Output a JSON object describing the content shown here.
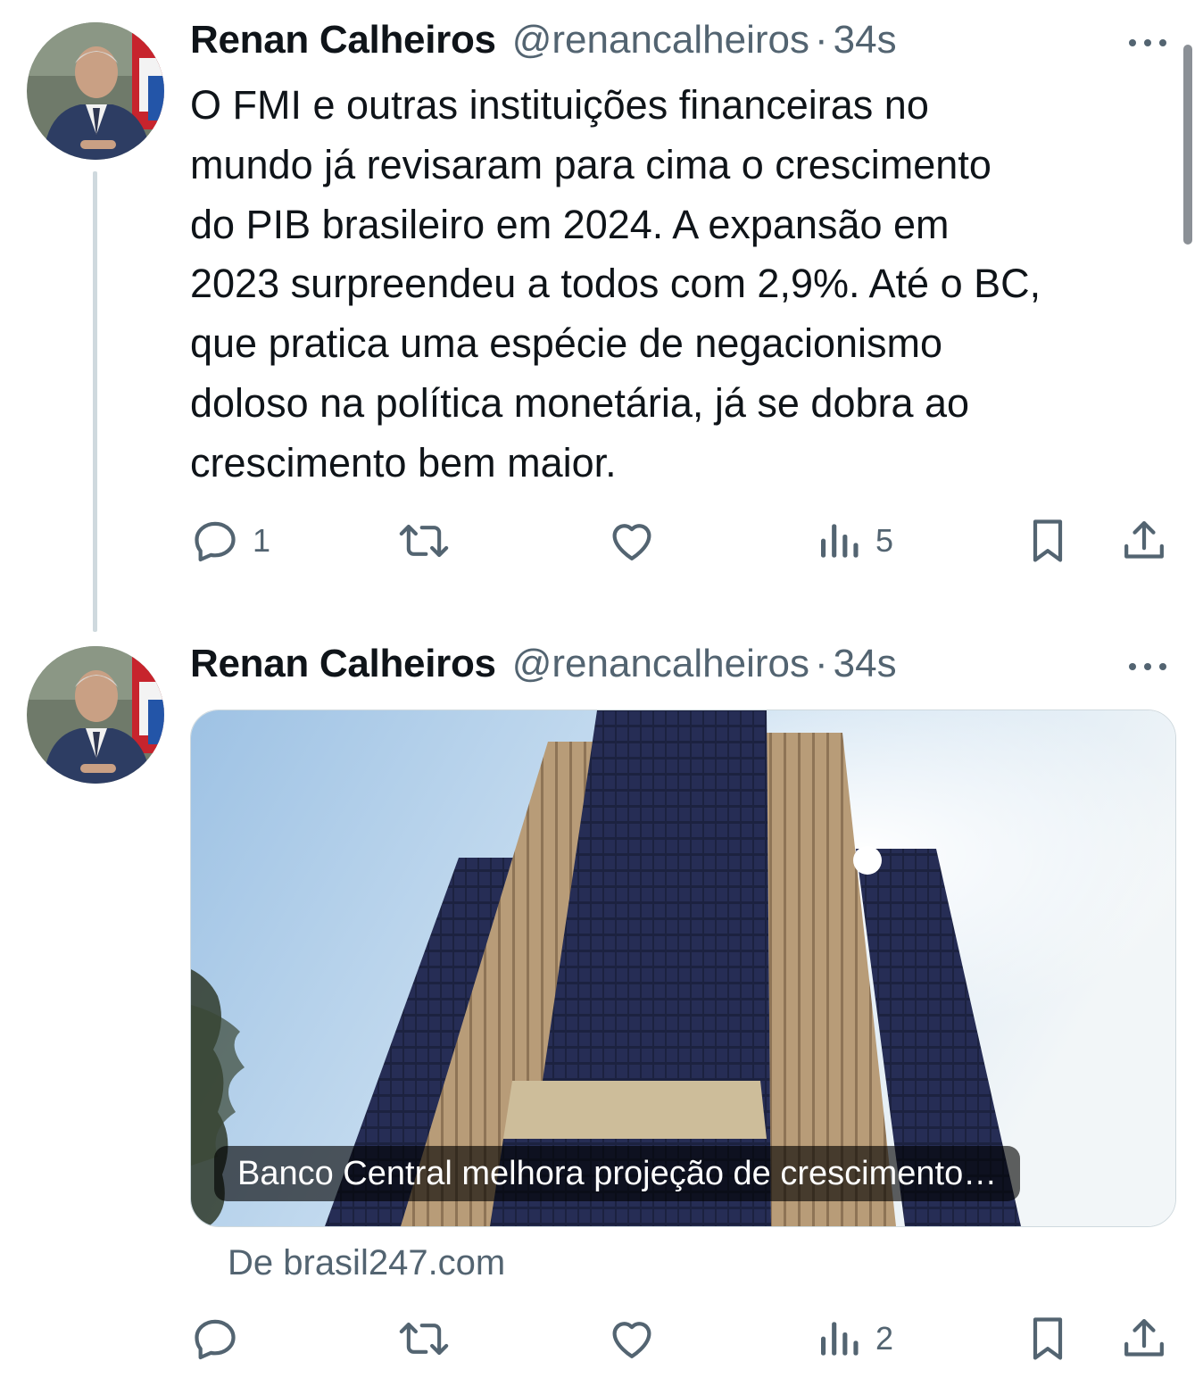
{
  "tweets": [
    {
      "author_name": "Renan Calheiros",
      "handle": "@renancalheiros",
      "separator": "·",
      "time": "34s",
      "text": "O FMI e outras instituições financeiras no\nmundo já revisaram para cima o crescimento\ndo PIB brasileiro em 2024. A expansão em\n2023 surpreendeu a todos com 2,9%. Até o BC,\nque pratica uma espécie de negacionismo\ndoloso na política monetária, já se dobra ao\ncrescimento bem maior.",
      "replies": "1",
      "views": "5"
    },
    {
      "author_name": "Renan Calheiros",
      "handle": "@renancalheiros",
      "separator": "·",
      "time": "34s",
      "card": {
        "title": "Banco Central melhora projeção de crescimento…",
        "source": "De brasil247.com"
      },
      "views": "2"
    }
  ],
  "icons": {
    "reply": "reply-icon",
    "retweet": "retweet-icon",
    "like": "heart-icon",
    "views": "views-icon",
    "bookmark": "bookmark-icon",
    "share": "share-icon",
    "more": "more-icon"
  },
  "colors": {
    "text": "#0f1419",
    "secondary": "#536471",
    "thread_line": "#cfd9de"
  }
}
